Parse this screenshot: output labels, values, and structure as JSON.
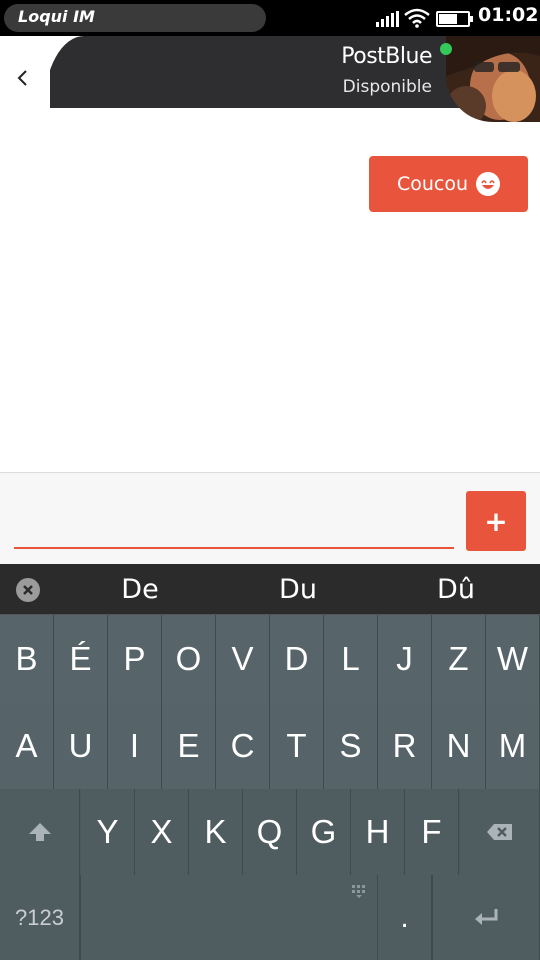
{
  "statusbar": {
    "app_name": "Loqui IM",
    "time": "01:02",
    "battery_level": 0.65
  },
  "header": {
    "contact_name": "PostBlue",
    "contact_status": "Disponible",
    "presence_color": "#34c759"
  },
  "chat": {
    "messages": [
      {
        "text": "Coucou",
        "emoji": "grinning-face-icon"
      }
    ]
  },
  "composer": {
    "input_value": "",
    "send_label": "+"
  },
  "suggestions": {
    "items": [
      "De",
      "Du",
      "Dû"
    ]
  },
  "keyboard": {
    "row1": [
      "B",
      "É",
      "P",
      "O",
      "V",
      "D",
      "L",
      "J",
      "Z",
      "W"
    ],
    "row2": [
      "A",
      "U",
      "I",
      "E",
      "C",
      "T",
      "S",
      "R",
      "N",
      "M"
    ],
    "row3": [
      "Y",
      "X",
      "K",
      "Q",
      "G",
      "H",
      "F"
    ],
    "symbols_label": "?123",
    "period_label": "."
  },
  "colors": {
    "accent": "#e8553c",
    "header_bg": "#2e2d30",
    "keyboard_bg": "#4a5558"
  }
}
